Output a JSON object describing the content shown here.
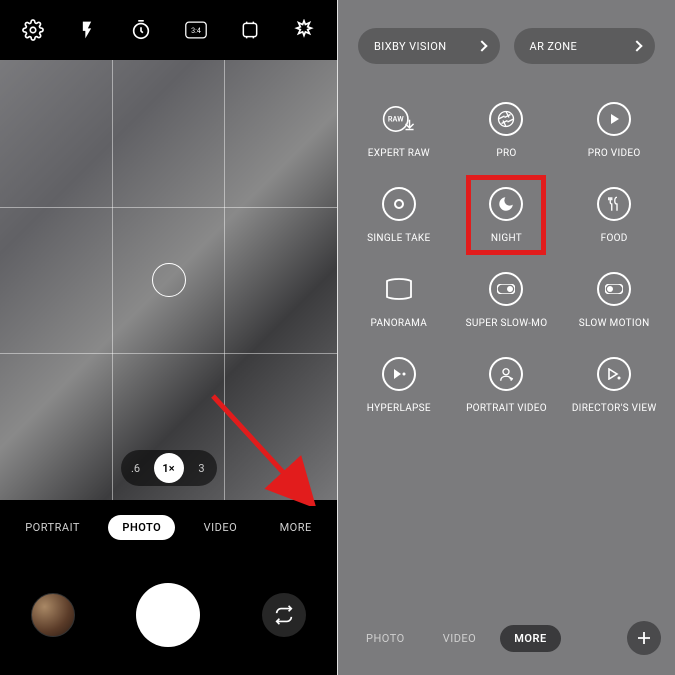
{
  "left": {
    "topbar": {
      "settings": "settings",
      "flash": "flash",
      "timer": "timer",
      "ratio": "3:4",
      "motion": "motion-photo",
      "filters": "filters"
    },
    "zoom": {
      "levels": [
        ".6",
        "1×",
        "3"
      ],
      "active_index": 1
    },
    "modes": [
      "PORTRAIT",
      "PHOTO",
      "VIDEO",
      "MORE"
    ],
    "active_mode_index": 1
  },
  "right": {
    "top_buttons": [
      "BIXBY VISION",
      "AR ZONE"
    ],
    "modes": [
      {
        "label": "EXPERT RAW",
        "icon": "raw"
      },
      {
        "label": "PRO",
        "icon": "aperture"
      },
      {
        "label": "PRO VIDEO",
        "icon": "play"
      },
      {
        "label": "SINGLE TAKE",
        "icon": "record"
      },
      {
        "label": "NIGHT",
        "icon": "moon",
        "highlight": true
      },
      {
        "label": "FOOD",
        "icon": "food"
      },
      {
        "label": "PANORAMA",
        "icon": "pano"
      },
      {
        "label": "SUPER SLOW-MO",
        "icon": "toggle"
      },
      {
        "label": "SLOW MOTION",
        "icon": "toggle2"
      },
      {
        "label": "HYPERLAPSE",
        "icon": "fast"
      },
      {
        "label": "PORTRAIT VIDEO",
        "icon": "portrait-vid"
      },
      {
        "label": "DIRECTOR'S VIEW",
        "icon": "director"
      }
    ],
    "tabs": [
      "PHOTO",
      "VIDEO",
      "MORE"
    ],
    "active_tab_index": 2,
    "plus": "+"
  }
}
